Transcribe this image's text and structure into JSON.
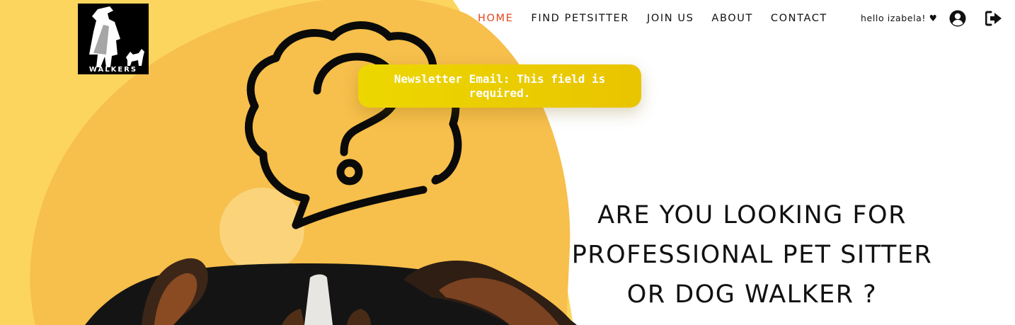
{
  "brand": {
    "logo_text": "WALKERS"
  },
  "nav": {
    "items": [
      {
        "label": "HOME",
        "active": true
      },
      {
        "label": "FIND PETSITTER",
        "active": false
      },
      {
        "label": "JOIN US",
        "active": false
      },
      {
        "label": "ABOUT",
        "active": false
      },
      {
        "label": "CONTACT",
        "active": false
      }
    ],
    "greeting": "hello izabela! ♥",
    "icons": {
      "user": "user-circle-icon",
      "logout": "sign-out-icon"
    }
  },
  "toast": {
    "message": "Newsletter Email: This field is required."
  },
  "hero": {
    "heading": "ARE YOU LOOKING FOR PROFESSIONAL PET SITTER OR DOG WALKER ?",
    "image": "dog-with-question-thought-bubble"
  },
  "colors": {
    "accent": "#e8431a",
    "hero_yellow": "#f7c04a",
    "toast_yellow": "#ecd700",
    "text": "#111111"
  }
}
